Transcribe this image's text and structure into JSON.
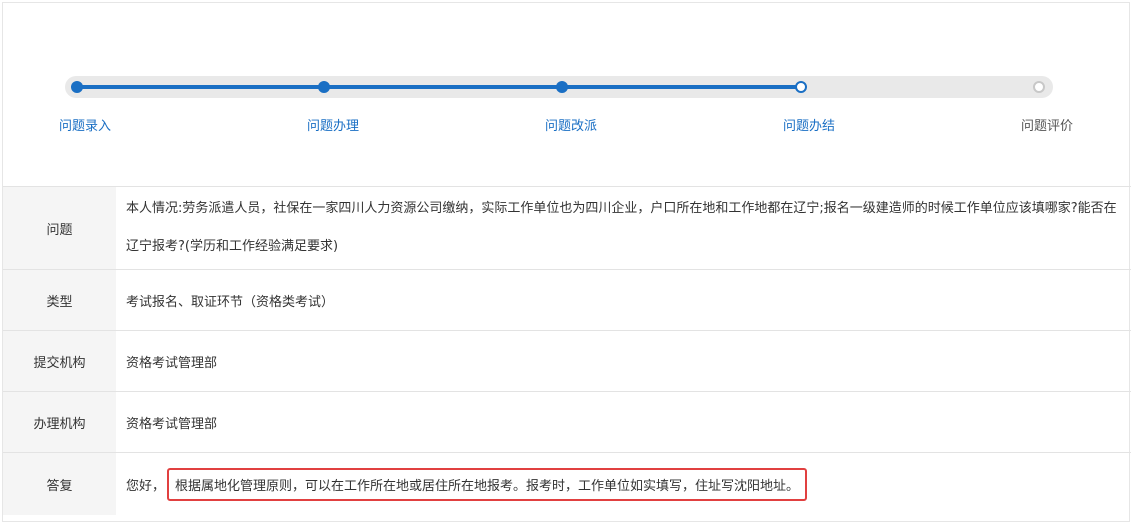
{
  "progress": {
    "steps": [
      {
        "label": "问题录入",
        "status": "done"
      },
      {
        "label": "问题办理",
        "status": "done"
      },
      {
        "label": "问题改派",
        "status": "done"
      },
      {
        "label": "问题办结",
        "status": "current"
      },
      {
        "label": "问题评价",
        "status": "todo"
      }
    ],
    "accent_color": "#1a6fc4"
  },
  "details": {
    "question": {
      "label": "问题",
      "value": "本人情况:劳务派遣人员，社保在一家四川人力资源公司缴纳，实际工作单位也为四川企业，户口所在地和工作地都在辽宁;报名一级建造师的时候工作单位应该填哪家?能否在辽宁报考?(学历和工作经验满足要求)"
    },
    "type": {
      "label": "类型",
      "value": "考试报名、取证环节（资格类考试）"
    },
    "submit_org": {
      "label": "提交机构",
      "value": "资格考试管理部"
    },
    "handle_org": {
      "label": "办理机构",
      "value": "资格考试管理部"
    },
    "answer": {
      "label": "答复",
      "prefix": "您好，",
      "highlight": "根据属地化管理原则，可以在工作所在地或居住所在地报考。报考时，工作单位如实填写，住址写沈阳地址。",
      "highlight_color": "#e14040"
    }
  }
}
